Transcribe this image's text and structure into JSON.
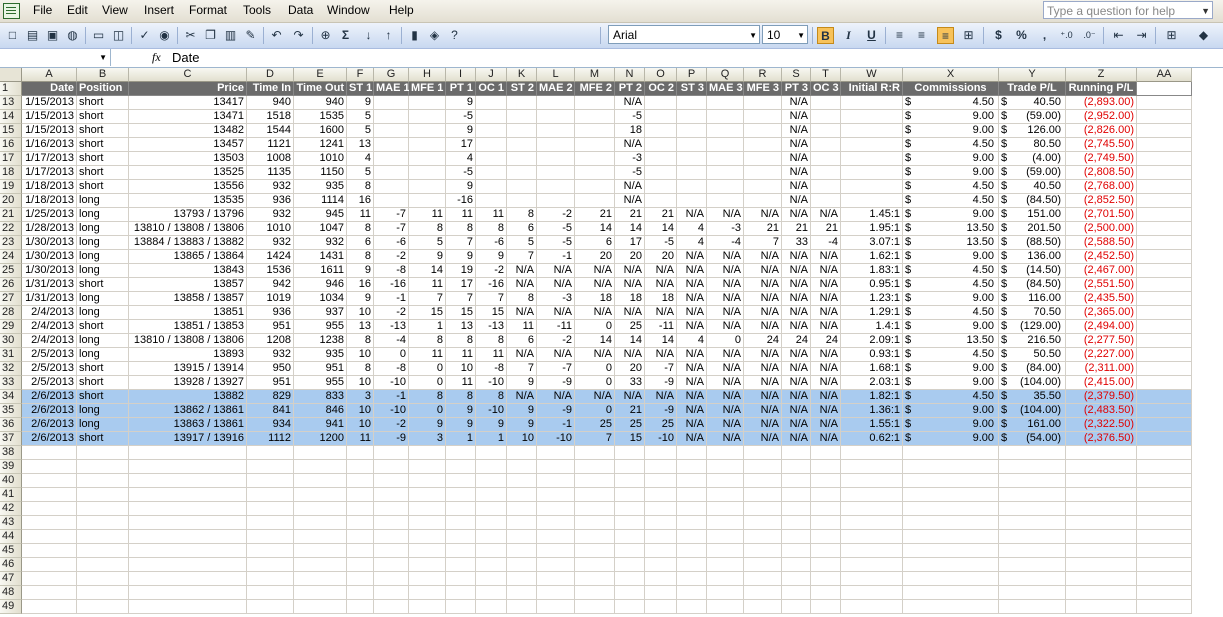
{
  "menu": {
    "items": [
      "File",
      "Edit",
      "View",
      "Insert",
      "Format",
      "Tools",
      "Data",
      "Window",
      "Help"
    ],
    "help_placeholder": "Type a question for help"
  },
  "toolbar": {
    "font": "Arial",
    "size": "10",
    "icons": [
      "new-icon",
      "open-icon",
      "save-icon",
      "permission-icon",
      "print-icon",
      "print-preview-icon",
      "spelling-icon",
      "research-icon",
      "cut-icon",
      "copy-icon",
      "paste-icon",
      "format-painter-icon",
      "undo-icon",
      "redo-icon",
      "hyperlink-icon",
      "autosum-icon",
      "sort-ascending-icon",
      "sort-descending-icon",
      "chart-wizard-icon",
      "drawing-icon",
      "help-icon"
    ],
    "bold_glyph": "B",
    "italic_glyph": "I",
    "underline_glyph": "U",
    "currency_glyph": "$",
    "percent_glyph": "%",
    "comma_glyph": ","
  },
  "formula": {
    "name_box": "",
    "fx": "fx",
    "value": "Date"
  },
  "columns": [
    "A",
    "B",
    "C",
    "D",
    "E",
    "F",
    "G",
    "H",
    "I",
    "J",
    "K",
    "L",
    "M",
    "N",
    "O",
    "P",
    "Q",
    "R",
    "S",
    "T",
    "W",
    "X",
    "Y",
    "Z",
    "AA"
  ],
  "header_row": {
    "row_number": "1",
    "labels": [
      "Date",
      "Position",
      "Price",
      "Time In",
      "Time Out",
      "ST 1",
      "MAE 1",
      "MFE 1",
      "PT 1",
      "OC 1",
      "ST 2",
      "MAE 2",
      "MFE 2",
      "PT 2",
      "OC 2",
      "ST 3",
      "MAE 3",
      "MFE 3",
      "PT 3",
      "OC 3",
      "Initial R:R",
      "Commissions",
      "Trade P/L",
      "Running P/L",
      ""
    ]
  },
  "rows": [
    {
      "n": "13",
      "sel": false,
      "v": [
        "1/15/2013",
        "short",
        "13417",
        "940",
        "940",
        "9",
        "",
        "",
        "9",
        "",
        "",
        "",
        "",
        "N/A",
        "",
        "",
        "",
        "",
        "N/A",
        "",
        "",
        "4.50",
        "40.50",
        "(2,893.00)"
      ]
    },
    {
      "n": "14",
      "sel": false,
      "v": [
        "1/15/2013",
        "short",
        "13471",
        "1518",
        "1535",
        "5",
        "",
        "",
        "-5",
        "",
        "",
        "",
        "",
        "-5",
        "",
        "",
        "",
        "",
        "N/A",
        "",
        "",
        "9.00",
        "(59.00)",
        "(2,952.00)"
      ]
    },
    {
      "n": "15",
      "sel": false,
      "v": [
        "1/15/2013",
        "short",
        "13482",
        "1544",
        "1600",
        "5",
        "",
        "",
        "9",
        "",
        "",
        "",
        "",
        "18",
        "",
        "",
        "",
        "",
        "N/A",
        "",
        "",
        "9.00",
        "126.00",
        "(2,826.00)"
      ]
    },
    {
      "n": "16",
      "sel": false,
      "v": [
        "1/16/2013",
        "short",
        "13457",
        "1121",
        "1241",
        "13",
        "",
        "",
        "17",
        "",
        "",
        "",
        "",
        "N/A",
        "",
        "",
        "",
        "",
        "N/A",
        "",
        "",
        "4.50",
        "80.50",
        "(2,745.50)"
      ]
    },
    {
      "n": "17",
      "sel": false,
      "v": [
        "1/17/2013",
        "short",
        "13503",
        "1008",
        "1010",
        "4",
        "",
        "",
        "4",
        "",
        "",
        "",
        "",
        "-3",
        "",
        "",
        "",
        "",
        "N/A",
        "",
        "",
        "9.00",
        "(4.00)",
        "(2,749.50)"
      ]
    },
    {
      "n": "18",
      "sel": false,
      "v": [
        "1/17/2013",
        "short",
        "13525",
        "1135",
        "1150",
        "5",
        "",
        "",
        "-5",
        "",
        "",
        "",
        "",
        "-5",
        "",
        "",
        "",
        "",
        "N/A",
        "",
        "",
        "9.00",
        "(59.00)",
        "(2,808.50)"
      ]
    },
    {
      "n": "19",
      "sel": false,
      "v": [
        "1/18/2013",
        "short",
        "13556",
        "932",
        "935",
        "8",
        "",
        "",
        "9",
        "",
        "",
        "",
        "",
        "N/A",
        "",
        "",
        "",
        "",
        "N/A",
        "",
        "",
        "4.50",
        "40.50",
        "(2,768.00)"
      ]
    },
    {
      "n": "20",
      "sel": false,
      "v": [
        "1/18/2013",
        "long",
        "13535",
        "936",
        "1114",
        "16",
        "",
        "",
        "-16",
        "",
        "",
        "",
        "",
        "N/A",
        "",
        "",
        "",
        "",
        "N/A",
        "",
        "",
        "4.50",
        "(84.50)",
        "(2,852.50)"
      ]
    },
    {
      "n": "21",
      "sel": false,
      "v": [
        "1/25/2013",
        "long",
        "13793 / 13796",
        "932",
        "945",
        "11",
        "-7",
        "11",
        "11",
        "11",
        "8",
        "-2",
        "21",
        "21",
        "21",
        "N/A",
        "N/A",
        "N/A",
        "N/A",
        "N/A",
        "1.45:1",
        "9.00",
        "151.00",
        "(2,701.50)"
      ]
    },
    {
      "n": "22",
      "sel": false,
      "v": [
        "1/28/2013",
        "long",
        "13810 / 13808 / 13806",
        "1010",
        "1047",
        "8",
        "-7",
        "8",
        "8",
        "8",
        "6",
        "-5",
        "14",
        "14",
        "14",
        "4",
        "-3",
        "21",
        "21",
        "21",
        "1.95:1",
        "13.50",
        "201.50",
        "(2,500.00)"
      ]
    },
    {
      "n": "23",
      "sel": false,
      "v": [
        "1/30/2013",
        "long",
        "13884 / 13883 / 13882",
        "932",
        "932",
        "6",
        "-6",
        "5",
        "7",
        "-6",
        "5",
        "-5",
        "6",
        "17",
        "-5",
        "4",
        "-4",
        "7",
        "33",
        "-4",
        "3.07:1",
        "13.50",
        "(88.50)",
        "(2,588.50)"
      ]
    },
    {
      "n": "24",
      "sel": false,
      "v": [
        "1/30/2013",
        "long",
        "13865 / 13864",
        "1424",
        "1431",
        "8",
        "-2",
        "9",
        "9",
        "9",
        "7",
        "-1",
        "20",
        "20",
        "20",
        "N/A",
        "N/A",
        "N/A",
        "N/A",
        "N/A",
        "1.62:1",
        "9.00",
        "136.00",
        "(2,452.50)"
      ]
    },
    {
      "n": "25",
      "sel": false,
      "v": [
        "1/30/2013",
        "long",
        "13843",
        "1536",
        "1611",
        "9",
        "-8",
        "14",
        "19",
        "-2",
        "N/A",
        "N/A",
        "N/A",
        "N/A",
        "N/A",
        "N/A",
        "N/A",
        "N/A",
        "N/A",
        "N/A",
        "1.83:1",
        "4.50",
        "(14.50)",
        "(2,467.00)"
      ]
    },
    {
      "n": "26",
      "sel": false,
      "v": [
        "1/31/2013",
        "short",
        "13857",
        "942",
        "946",
        "16",
        "-16",
        "11",
        "17",
        "-16",
        "N/A",
        "N/A",
        "N/A",
        "N/A",
        "N/A",
        "N/A",
        "N/A",
        "N/A",
        "N/A",
        "N/A",
        "0.95:1",
        "4.50",
        "(84.50)",
        "(2,551.50)"
      ]
    },
    {
      "n": "27",
      "sel": false,
      "v": [
        "1/31/2013",
        "long",
        "13858 / 13857",
        "1019",
        "1034",
        "9",
        "-1",
        "7",
        "7",
        "7",
        "8",
        "-3",
        "18",
        "18",
        "18",
        "N/A",
        "N/A",
        "N/A",
        "N/A",
        "N/A",
        "1.23:1",
        "9.00",
        "116.00",
        "(2,435.50)"
      ]
    },
    {
      "n": "28",
      "sel": false,
      "v": [
        "2/4/2013",
        "long",
        "13851",
        "936",
        "937",
        "10",
        "-2",
        "15",
        "15",
        "15",
        "N/A",
        "N/A",
        "N/A",
        "N/A",
        "N/A",
        "N/A",
        "N/A",
        "N/A",
        "N/A",
        "N/A",
        "1.29:1",
        "4.50",
        "70.50",
        "(2,365.00)"
      ]
    },
    {
      "n": "29",
      "sel": false,
      "v": [
        "2/4/2013",
        "short",
        "13851 / 13853",
        "951",
        "955",
        "13",
        "-13",
        "1",
        "13",
        "-13",
        "11",
        "-11",
        "0",
        "25",
        "-11",
        "N/A",
        "N/A",
        "N/A",
        "N/A",
        "N/A",
        "1.4:1",
        "9.00",
        "(129.00)",
        "(2,494.00)"
      ]
    },
    {
      "n": "30",
      "sel": false,
      "v": [
        "2/4/2013",
        "long",
        "13810 / 13808 / 13806",
        "1208",
        "1238",
        "8",
        "-4",
        "8",
        "8",
        "8",
        "6",
        "-2",
        "14",
        "14",
        "14",
        "4",
        "0",
        "24",
        "24",
        "24",
        "2.09:1",
        "13.50",
        "216.50",
        "(2,277.50)"
      ]
    },
    {
      "n": "31",
      "sel": false,
      "v": [
        "2/5/2013",
        "long",
        "13893",
        "932",
        "935",
        "10",
        "0",
        "11",
        "11",
        "11",
        "N/A",
        "N/A",
        "N/A",
        "N/A",
        "N/A",
        "N/A",
        "N/A",
        "N/A",
        "N/A",
        "N/A",
        "0.93:1",
        "4.50",
        "50.50",
        "(2,227.00)"
      ]
    },
    {
      "n": "32",
      "sel": false,
      "v": [
        "2/5/2013",
        "short",
        "13915 / 13914",
        "950",
        "951",
        "8",
        "-8",
        "0",
        "10",
        "-8",
        "7",
        "-7",
        "0",
        "20",
        "-7",
        "N/A",
        "N/A",
        "N/A",
        "N/A",
        "N/A",
        "1.68:1",
        "9.00",
        "(84.00)",
        "(2,311.00)"
      ]
    },
    {
      "n": "33",
      "sel": false,
      "v": [
        "2/5/2013",
        "short",
        "13928 / 13927",
        "951",
        "955",
        "10",
        "-10",
        "0",
        "11",
        "-10",
        "9",
        "-9",
        "0",
        "33",
        "-9",
        "N/A",
        "N/A",
        "N/A",
        "N/A",
        "N/A",
        "2.03:1",
        "9.00",
        "(104.00)",
        "(2,415.00)"
      ]
    },
    {
      "n": "34",
      "sel": true,
      "v": [
        "2/6/2013",
        "short",
        "13882",
        "829",
        "833",
        "3",
        "-1",
        "8",
        "8",
        "8",
        "N/A",
        "N/A",
        "N/A",
        "N/A",
        "N/A",
        "N/A",
        "N/A",
        "N/A",
        "N/A",
        "N/A",
        "1.82:1",
        "4.50",
        "35.50",
        "(2,379.50)"
      ]
    },
    {
      "n": "35",
      "sel": true,
      "v": [
        "2/6/2013",
        "long",
        "13862 / 13861",
        "841",
        "846",
        "10",
        "-10",
        "0",
        "9",
        "-10",
        "9",
        "-9",
        "0",
        "21",
        "-9",
        "N/A",
        "N/A",
        "N/A",
        "N/A",
        "N/A",
        "1.36:1",
        "9.00",
        "(104.00)",
        "(2,483.50)"
      ]
    },
    {
      "n": "36",
      "sel": true,
      "v": [
        "2/6/2013",
        "long",
        "13863 / 13861",
        "934",
        "941",
        "10",
        "-2",
        "9",
        "9",
        "9",
        "9",
        "-1",
        "25",
        "25",
        "25",
        "N/A",
        "N/A",
        "N/A",
        "N/A",
        "N/A",
        "1.55:1",
        "9.00",
        "161.00",
        "(2,322.50)"
      ]
    },
    {
      "n": "37",
      "sel": true,
      "v": [
        "2/6/2013",
        "short",
        "13917 / 13916",
        "1112",
        "1200",
        "11",
        "-9",
        "3",
        "1",
        "1",
        "10",
        "-10",
        "7",
        "15",
        "-10",
        "N/A",
        "N/A",
        "N/A",
        "N/A",
        "N/A",
        "0.62:1",
        "9.00",
        "(54.00)",
        "(2,376.50)"
      ]
    }
  ],
  "empty_rows": [
    "38",
    "39",
    "40",
    "41",
    "42",
    "43",
    "44",
    "45",
    "46",
    "47",
    "48",
    "49"
  ],
  "currency_symbol": "$",
  "colors": {
    "selection": "#a9cbef",
    "header_fill": "#6b6b6b",
    "negative": "#e00000"
  }
}
